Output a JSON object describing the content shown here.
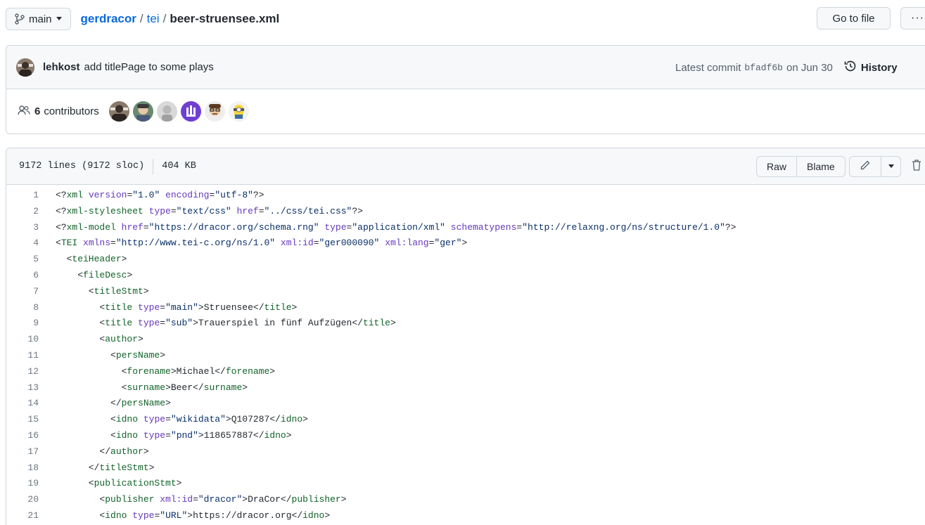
{
  "branch": {
    "name": "main"
  },
  "breadcrumb": {
    "owner": "gerdracor",
    "repo": "tei",
    "separator": "/",
    "file": "beer-struensee.xml"
  },
  "actions": {
    "go_to_file": "Go to file",
    "more": "···"
  },
  "commit": {
    "author": "lehkost",
    "message": "add titlePage to some plays",
    "latest_label": "Latest commit",
    "sha": "bfadf6b",
    "date": "on Jun 30",
    "history_label": "History"
  },
  "contributors": {
    "count": "6",
    "label": "contributors"
  },
  "file": {
    "lines_info": "9172 lines (9172 sloc)",
    "size": "404 KB",
    "raw_label": "Raw",
    "blame_label": "Blame"
  },
  "code_lines": [
    {
      "n": "1",
      "text": "<?xml version=\"1.0\" encoding=\"utf-8\"?>"
    },
    {
      "n": "2",
      "text": "<?xml-stylesheet type=\"text/css\" href=\"../css/tei.css\"?>"
    },
    {
      "n": "3",
      "text": "<?xml-model href=\"https://dracor.org/schema.rng\" type=\"application/xml\" schematypens=\"http://relaxng.org/ns/structure/1.0\"?>"
    },
    {
      "n": "4",
      "text": "<TEI xmlns=\"http://www.tei-c.org/ns/1.0\" xml:id=\"ger000090\" xml:lang=\"ger\">"
    },
    {
      "n": "5",
      "text": "  <teiHeader>"
    },
    {
      "n": "6",
      "text": "    <fileDesc>"
    },
    {
      "n": "7",
      "text": "      <titleStmt>"
    },
    {
      "n": "8",
      "text": "        <title type=\"main\">Struensee</title>"
    },
    {
      "n": "9",
      "text": "        <title type=\"sub\">Trauerspiel in fünf Aufzügen</title>"
    },
    {
      "n": "10",
      "text": "        <author>"
    },
    {
      "n": "11",
      "text": "          <persName>"
    },
    {
      "n": "12",
      "text": "            <forename>Michael</forename>"
    },
    {
      "n": "13",
      "text": "            <surname>Beer</surname>"
    },
    {
      "n": "14",
      "text": "          </persName>"
    },
    {
      "n": "15",
      "text": "          <idno type=\"wikidata\">Q107287</idno>"
    },
    {
      "n": "16",
      "text": "          <idno type=\"pnd\">118657887</idno>"
    },
    {
      "n": "17",
      "text": "        </author>"
    },
    {
      "n": "18",
      "text": "      </titleStmt>"
    },
    {
      "n": "19",
      "text": "      <publicationStmt>"
    },
    {
      "n": "20",
      "text": "        <publisher xml:id=\"dracor\">DraCor</publisher>"
    },
    {
      "n": "21",
      "text": "        <idno type=\"URL\">https://dracor.org</idno>"
    }
  ],
  "colors": {
    "link": "#0969da",
    "tag": "#116329",
    "attr": "#6639ba",
    "string": "#0a3069",
    "border": "#d0d7de"
  }
}
